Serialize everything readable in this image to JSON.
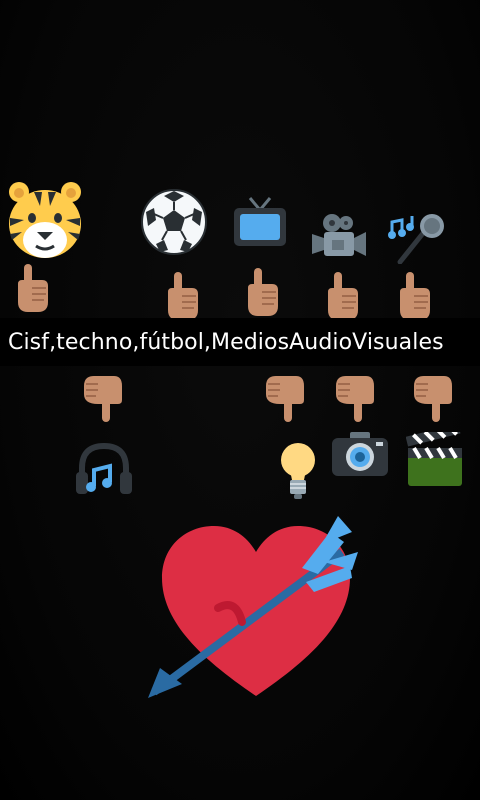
{
  "caption": "Cisf,techno,fútbol,MediosAudioVisuales",
  "colors": {
    "background": "#000000",
    "caption_text": "#ffffff",
    "heart": "#dd2e44",
    "arrow": "#55acee"
  },
  "icons": {
    "top_row": [
      "tiger-face-icon",
      "soccer-ball-icon",
      "television-icon",
      "movie-camera-icon",
      "microphone-music-icon"
    ],
    "pointing_up": [
      "pointing-up-hand-icon",
      "pointing-up-hand-icon",
      "pointing-up-hand-icon",
      "pointing-up-hand-icon",
      "pointing-up-hand-icon"
    ],
    "pointing_down": [
      "pointing-down-hand-icon",
      "pointing-down-hand-icon",
      "pointing-down-hand-icon",
      "pointing-down-hand-icon"
    ],
    "bottom_row": [
      "headphones-icon",
      "light-bulb-icon",
      "camera-icon",
      "clapper-board-icon"
    ],
    "large": "heart-with-arrow-icon"
  }
}
